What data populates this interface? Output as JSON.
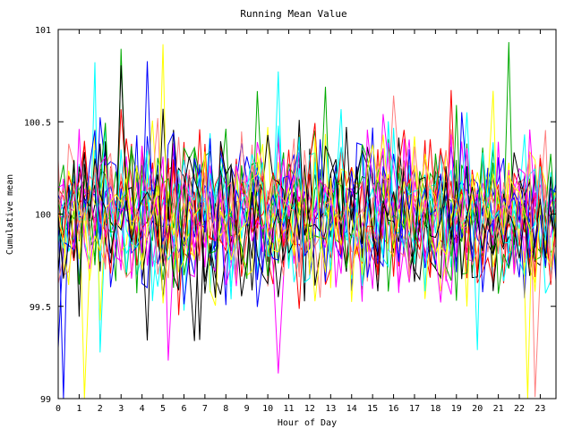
{
  "chart_data": {
    "type": "line",
    "title": "Running Mean Value",
    "xlabel": "Hour of Day",
    "ylabel": "Cumulative mean",
    "xlim": [
      0,
      23.75
    ],
    "ylim": [
      99,
      101
    ],
    "x_ticks": [
      "0",
      "1",
      "2",
      "3",
      "4",
      "5",
      "6",
      "7",
      "8",
      "9",
      "10",
      "11",
      "12",
      "13",
      "14",
      "15",
      "16",
      "17",
      "18",
      "19",
      "20",
      "21",
      "22",
      "23"
    ],
    "y_ticks": [
      "99",
      "99.5",
      "100",
      "100.5",
      "101"
    ],
    "grid": false,
    "legend": "none",
    "series_count": 24,
    "points_per_series": 96,
    "central_value": 100.0,
    "typical_band": [
      99.6,
      100.4
    ],
    "observed_extremes": {
      "max": 100.92,
      "min": 99.0
    },
    "series_colors": [
      "#ff0000",
      "#00aa00",
      "#0000ff",
      "#ff00ff",
      "#00ffff",
      "#ffff00",
      "#000000",
      "#ff8080"
    ]
  }
}
